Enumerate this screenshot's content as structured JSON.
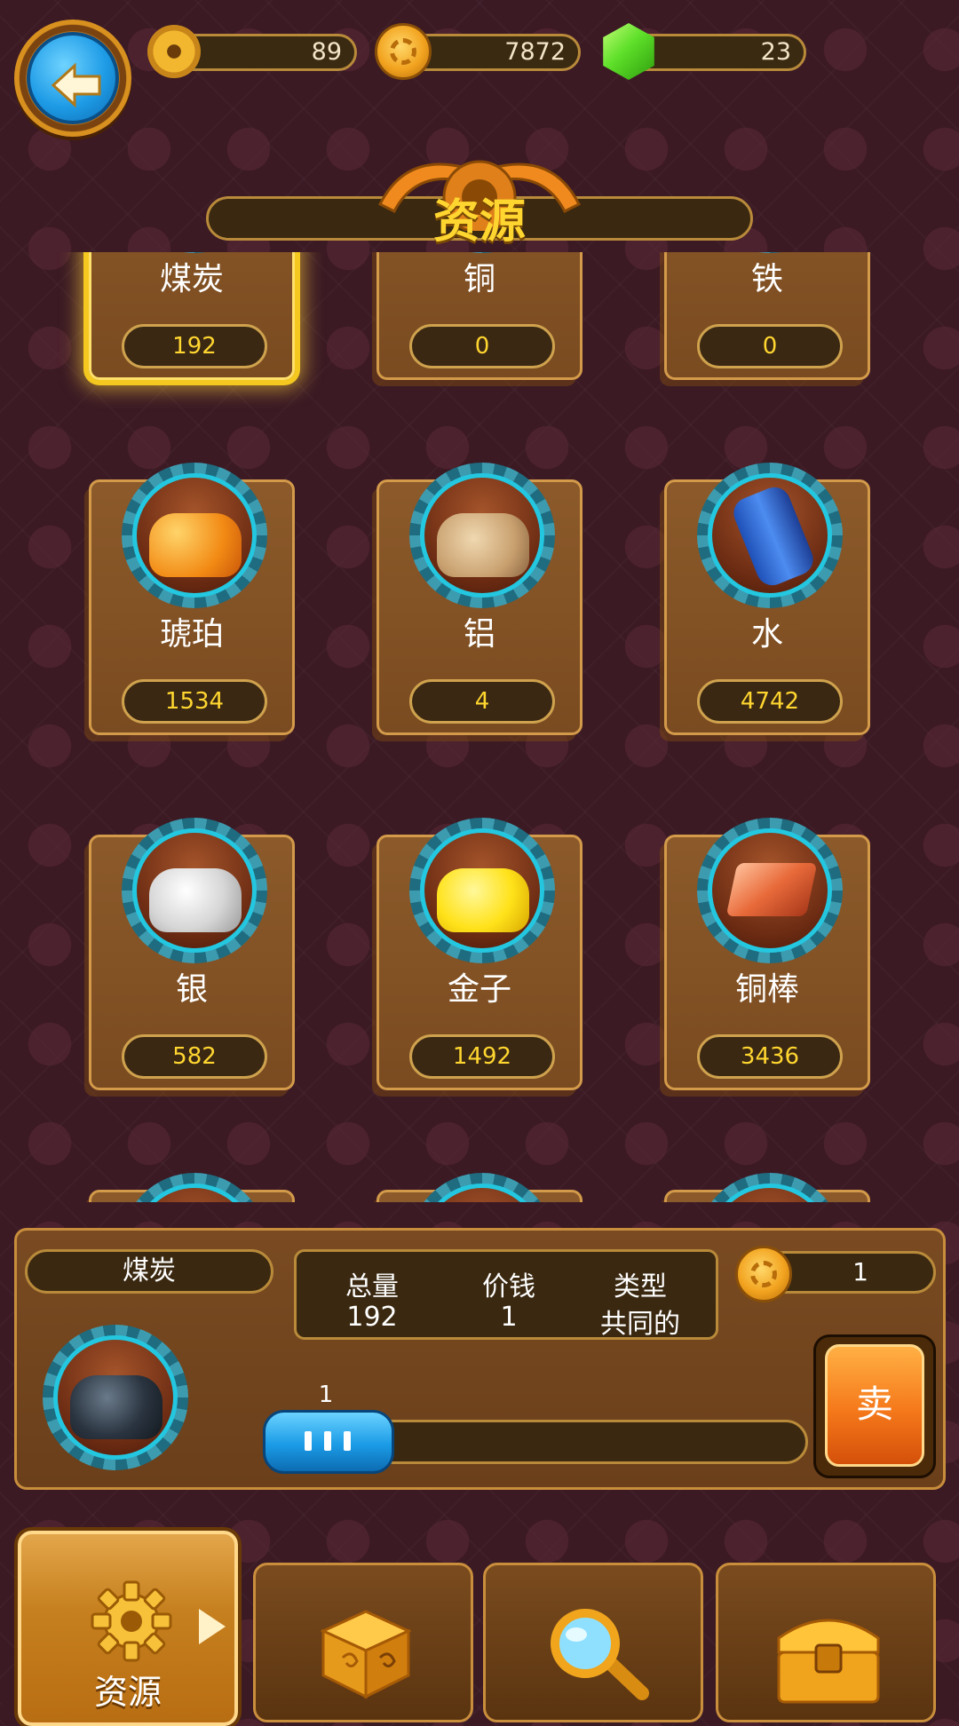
{
  "currency": {
    "gears": "89",
    "coins": "7872",
    "gems": "23"
  },
  "title": "资源",
  "grid": {
    "row1": [
      {
        "name": "煤炭",
        "count": "192"
      },
      {
        "name": "铜",
        "count": "0"
      },
      {
        "name": "铁",
        "count": "0"
      }
    ],
    "row2": [
      {
        "name": "琥珀",
        "count": "1534"
      },
      {
        "name": "铝",
        "count": "4"
      },
      {
        "name": "水",
        "count": "4742"
      }
    ],
    "row3": [
      {
        "name": "银",
        "count": "582"
      },
      {
        "name": "金子",
        "count": "1492"
      },
      {
        "name": "铜棒",
        "count": "3436"
      }
    ]
  },
  "selected": {
    "name": "煤炭",
    "total_label": "总量",
    "total_value": "192",
    "price_label": "价钱",
    "price_value": "1",
    "type_label": "类型",
    "type_value": "共同的",
    "sell_price": "1",
    "slider_value": "1",
    "sell_label": "卖"
  },
  "nav": {
    "resources_label": "资源"
  },
  "colors": {
    "accent_gold": "#ffd630",
    "button_blue": "#1b9be6",
    "sell_orange": "#f5781a",
    "background": "#3b1a24"
  },
  "icons": {
    "back": "arrow-left-icon",
    "gear": "gear-icon",
    "coin": "coin-icon",
    "gem": "gem-icon",
    "dice": "dice-icon",
    "search": "magnifier-icon",
    "chest": "chest-icon"
  }
}
